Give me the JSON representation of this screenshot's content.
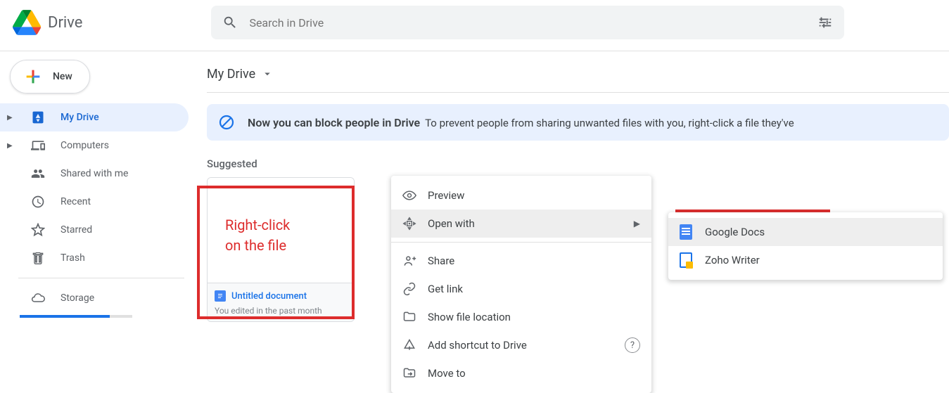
{
  "header": {
    "product": "Drive",
    "search_placeholder": "Search in Drive"
  },
  "sidebar": {
    "new_label": "New",
    "items": [
      {
        "id": "my-drive",
        "label": "My Drive",
        "expander": true,
        "icon": "drive",
        "active": true
      },
      {
        "id": "computers",
        "label": "Computers",
        "expander": true,
        "icon": "devices"
      },
      {
        "id": "shared",
        "label": "Shared with me",
        "icon": "people"
      },
      {
        "id": "recent",
        "label": "Recent",
        "icon": "clock"
      },
      {
        "id": "starred",
        "label": "Starred",
        "icon": "star"
      },
      {
        "id": "trash",
        "label": "Trash",
        "icon": "trash"
      }
    ],
    "storage_label": "Storage"
  },
  "breadcrumb": "My Drive",
  "banner": {
    "title": "Now you can block people in Drive",
    "desc": "To prevent people from sharing unwanted files with you, right-click a file they've"
  },
  "suggested_header": "Suggested",
  "suggested": [
    {
      "title": "Untitled document",
      "subtitle": "You edited in the past month"
    }
  ],
  "context_menu": [
    {
      "id": "preview",
      "label": "Preview"
    },
    {
      "id": "open-with",
      "label": "Open with",
      "hover": true,
      "submenu": true
    },
    {
      "sep": true
    },
    {
      "id": "share",
      "label": "Share"
    },
    {
      "id": "get-link",
      "label": "Get link"
    },
    {
      "id": "show-loc",
      "label": "Show file location"
    },
    {
      "id": "shortcut",
      "label": "Add shortcut to Drive",
      "help": true
    },
    {
      "id": "move",
      "label": "Move to"
    }
  ],
  "submenu": [
    {
      "id": "gdocs",
      "label": "Google Docs",
      "hover": true,
      "iconClass": "docs"
    },
    {
      "id": "zoho",
      "label": "Zoho Writer",
      "iconClass": "zoho"
    }
  ],
  "annotations": {
    "text_line1": "Right-click",
    "text_line2": "on the file"
  }
}
